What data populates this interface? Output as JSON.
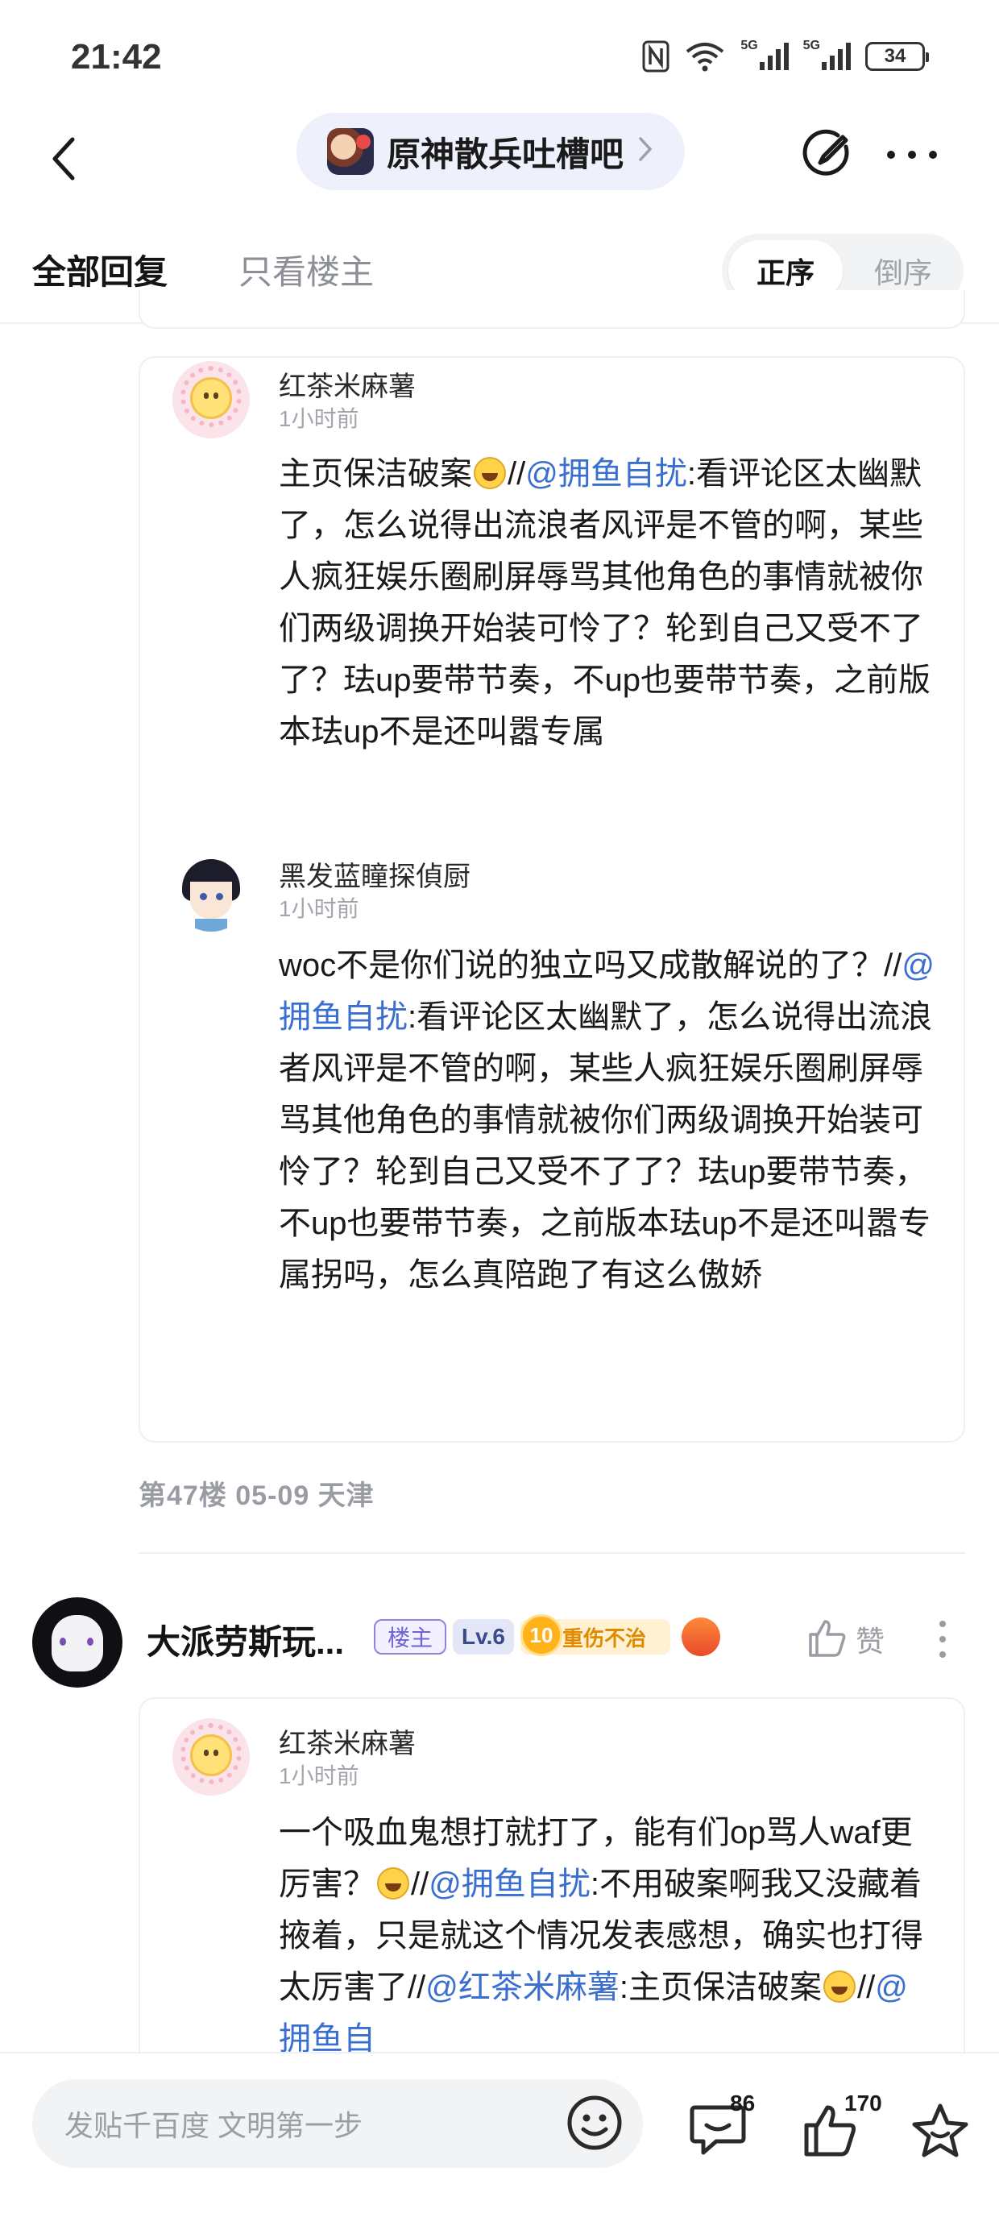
{
  "status_bar": {
    "time": "21:42",
    "signal1_label": "5G",
    "signal2_label": "5G",
    "battery": "34",
    "icons": [
      "nfc-icon",
      "wifi-icon",
      "signal-5g-icon",
      "signal-5g-icon",
      "battery-icon"
    ]
  },
  "header": {
    "forum_name": "原神散兵吐槽吧",
    "icons": [
      "back-arrow-icon",
      "chevron-right-icon",
      "edit-icon",
      "more-icon"
    ]
  },
  "tabs": {
    "all_replies": "全部回复",
    "only_op": "只看楼主",
    "sort_asc": "正序",
    "sort_desc": "倒序"
  },
  "floor47": {
    "quotes": [
      {
        "name": "红茶米麻薯",
        "time": "1小时前",
        "text_before": "主页保洁破案",
        "sep": "//",
        "mention": "@拥鱼自扰",
        "text_after": ":看评论区太幽默了，怎么说得出流浪者风评是不管的啊，某些人疯狂娱乐圈刷屏辱骂其他角色的事情就被你们两级调换开始装可怜了？轮到自己又受不了了？珐up要带节奏，不up也要带节奏，之前版本珐up不是还叫嚣专属"
      },
      {
        "name": "黑发蓝瞳探偵厨",
        "time": "1小时前",
        "text_before": "woc不是你们说的独立吗又成散解说的了？//",
        "mention": "@拥鱼自扰",
        "text_after": ":看评论区太幽默了，怎么说得出流浪者风评是不管的啊，某些人疯狂娱乐圈刷屏辱骂其他角色的事情就被你们两级调换开始装可怜了？轮到自己又受不了了？珐up要带节奏，不up也要带节奏，之前版本珐up不是还叫嚣专属拐吗，怎么真陪跑了有这么傲娇"
      }
    ],
    "meta": "第47楼  05-09  天津"
  },
  "floor48": {
    "user_name": "大派劳斯玩...",
    "badge_op": "楼主",
    "badge_level": "Lv.6",
    "fan_level": "10",
    "fan_title": "重伤不治",
    "like_label": "赞",
    "quote": {
      "name": "红茶米麻薯",
      "time": "1小时前",
      "text_before": "一个吸血鬼想打就打了，能有们op骂人waf更厉害？",
      "sep1": "//",
      "mention1": "@拥鱼自扰",
      "text_mid": ":不用破案啊我又没藏着掖着，只是就这个情况发表感想，确实也打得太厉害了//",
      "mention2": "@红茶米麻薯",
      "text_mid2": ":主页保洁破案",
      "sep2": "//",
      "mention3": "@拥鱼自"
    }
  },
  "bottom_bar": {
    "placeholder": "发贴千百度 文明第一步",
    "comment_count": "86",
    "like_count": "170",
    "icons": [
      "emoji-icon",
      "comment-icon",
      "thumbs-up-icon",
      "star-icon"
    ]
  }
}
